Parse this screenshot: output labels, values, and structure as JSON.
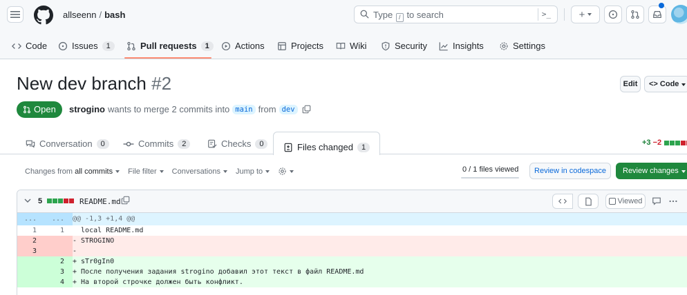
{
  "header": {
    "owner": "allseenn",
    "separator": "/",
    "repo": "bash",
    "search_placeholder_before": "Type",
    "search_placeholder_key": "/",
    "search_placeholder_after": "to search",
    "command_glyph": ">_",
    "plus_glyph": "+"
  },
  "nav": {
    "items": [
      {
        "label": "Code",
        "icon": "code-icon"
      },
      {
        "label": "Issues",
        "icon": "issue-opened-icon",
        "count": "1"
      },
      {
        "label": "Pull requests",
        "icon": "git-pull-request-icon",
        "count": "1",
        "active": true
      },
      {
        "label": "Actions",
        "icon": "play-icon"
      },
      {
        "label": "Projects",
        "icon": "table-icon"
      },
      {
        "label": "Wiki",
        "icon": "book-icon"
      },
      {
        "label": "Security",
        "icon": "shield-icon"
      },
      {
        "label": "Insights",
        "icon": "graph-icon"
      },
      {
        "label": "Settings",
        "icon": "gear-icon"
      }
    ]
  },
  "pr": {
    "title": "New dev branch",
    "number": "#2",
    "state": "Open",
    "author": "strogino",
    "meta_text": "wants to merge 2 commits into",
    "base_branch": "main",
    "from_text": "from",
    "head_branch": "dev",
    "edit_label": "Edit",
    "code_label": "Code"
  },
  "tabs": [
    {
      "label": "Conversation",
      "count": "0",
      "icon": "comment-discussion-icon"
    },
    {
      "label": "Commits",
      "count": "2",
      "icon": "git-commit-icon"
    },
    {
      "label": "Checks",
      "count": "0",
      "icon": "checklist-icon"
    },
    {
      "label": "Files changed",
      "count": "1",
      "icon": "file-diff-icon",
      "active": true
    }
  ],
  "diffstat": {
    "additions": "+3",
    "deletions": "−2"
  },
  "toolbar": {
    "changes_from_prefix": "Changes from",
    "changes_from_value": "all commits",
    "file_filter": "File filter",
    "conversations": "Conversations",
    "jump_to": "Jump to",
    "files_viewed": "0 / 1 files viewed",
    "review_codespace": "Review in codespace",
    "review_changes": "Review changes"
  },
  "file": {
    "changes_count": "5",
    "name": "README.md",
    "viewed_label": "Viewed"
  },
  "diff_lines": [
    {
      "type": "hunk",
      "old": "...",
      "new": "...",
      "text": "@@ -1,3 +1,4 @@"
    },
    {
      "type": "ctx",
      "old": "1",
      "new": "1",
      "text": "  local README.md"
    },
    {
      "type": "del",
      "old": "2",
      "new": "",
      "text": "- STROGINO"
    },
    {
      "type": "del",
      "old": "3",
      "new": "",
      "text": "-"
    },
    {
      "type": "add",
      "old": "",
      "new": "2",
      "text": "+ sTr0gIn0"
    },
    {
      "type": "add",
      "old": "",
      "new": "3",
      "text": "+ После получения задания strogino добавил этот текст в файл README.md"
    },
    {
      "type": "add",
      "old": "",
      "new": "4",
      "text": "+ На второй строчке должен быть конфликт."
    }
  ],
  "colors": {
    "accent_green": "#1f883d",
    "link_blue": "#0969da",
    "nav_underline": "#fd8c73",
    "add_bg": "#e6ffec",
    "del_bg": "#ffebe9",
    "hunk_bg": "#ddf4ff"
  }
}
